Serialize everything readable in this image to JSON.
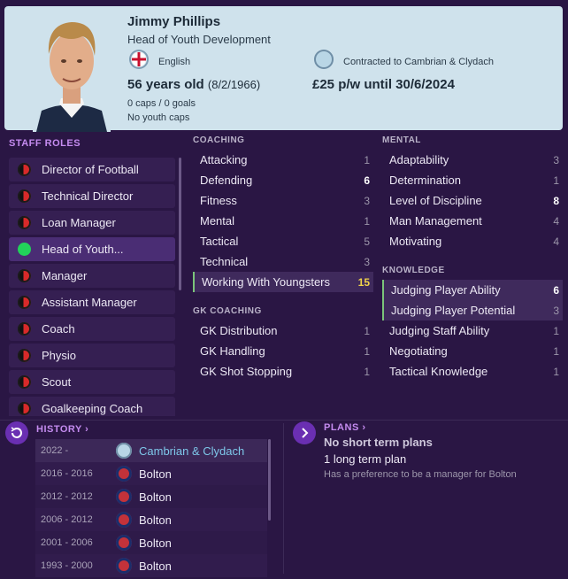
{
  "header": {
    "name": "Jimmy Phillips",
    "job": "Head of Youth Development",
    "nationality": "English",
    "contract_club": "Contracted to Cambrian & Clydach",
    "age": "56 years old",
    "dob": "(8/2/1966)",
    "wage": "£25 p/w until 30/6/2024",
    "caps": "0 caps / 0 goals",
    "youth_caps": "No youth caps"
  },
  "staff_roles": {
    "title": "STAFF ROLES",
    "items": [
      {
        "label": "Director of Football",
        "active": false
      },
      {
        "label": "Technical Director",
        "active": false
      },
      {
        "label": "Loan Manager",
        "active": false
      },
      {
        "label": "Head of Youth...",
        "active": true
      },
      {
        "label": "Manager",
        "active": false
      },
      {
        "label": "Assistant Manager",
        "active": false
      },
      {
        "label": "Coach",
        "active": false
      },
      {
        "label": "Physio",
        "active": false
      },
      {
        "label": "Scout",
        "active": false
      },
      {
        "label": "Goalkeeping Coach",
        "active": false
      }
    ]
  },
  "coaching": {
    "title": "COACHING",
    "items": [
      {
        "label": "Attacking",
        "value": "1"
      },
      {
        "label": "Defending",
        "value": "6"
      },
      {
        "label": "Fitness",
        "value": "3"
      },
      {
        "label": "Mental",
        "value": "1"
      },
      {
        "label": "Tactical",
        "value": "5"
      },
      {
        "label": "Technical",
        "value": "3"
      },
      {
        "label": "Working With Youngsters",
        "value": "15"
      }
    ]
  },
  "gk_coaching": {
    "title": "GK COACHING",
    "items": [
      {
        "label": "GK Distribution",
        "value": "1"
      },
      {
        "label": "GK Handling",
        "value": "1"
      },
      {
        "label": "GK Shot Stopping",
        "value": "1"
      }
    ]
  },
  "mental": {
    "title": "MENTAL",
    "items": [
      {
        "label": "Adaptability",
        "value": "3"
      },
      {
        "label": "Determination",
        "value": "1"
      },
      {
        "label": "Level of Discipline",
        "value": "8"
      },
      {
        "label": "Man Management",
        "value": "4"
      },
      {
        "label": "Motivating",
        "value": "4"
      }
    ]
  },
  "knowledge": {
    "title": "KNOWLEDGE",
    "items": [
      {
        "label": "Judging Player Ability",
        "value": "6"
      },
      {
        "label": "Judging Player Potential",
        "value": "3"
      },
      {
        "label": "Judging Staff Ability",
        "value": "1"
      },
      {
        "label": "Negotiating",
        "value": "1"
      },
      {
        "label": "Tactical Knowledge",
        "value": "1"
      }
    ]
  },
  "history": {
    "title": "HISTORY",
    "rows": [
      {
        "years": "2022 -",
        "club": "Cambrian & Clydach"
      },
      {
        "years": "2016 - 2016",
        "club": "Bolton"
      },
      {
        "years": "2012 - 2012",
        "club": "Bolton"
      },
      {
        "years": "2006 - 2012",
        "club": "Bolton"
      },
      {
        "years": "2001 - 2006",
        "club": "Bolton"
      },
      {
        "years": "1993 - 2000",
        "club": "Bolton"
      }
    ]
  },
  "plans": {
    "title": "PLANS",
    "short_term": "No short term plans",
    "long_term": "1 long term plan",
    "preference": "Has a preference to be a manager for Bolton"
  },
  "icons": {
    "history_button": "history-icon",
    "plans_button": "chevron-right-icon",
    "nationality_flag": "england-flag-icon",
    "club_badge": "club-badge-icon"
  },
  "colors": {
    "accent": "#6a2fb2",
    "header_bg": "#cfe2ec",
    "highlight_value": "#f0d34a",
    "active_role": "#22d25a"
  }
}
